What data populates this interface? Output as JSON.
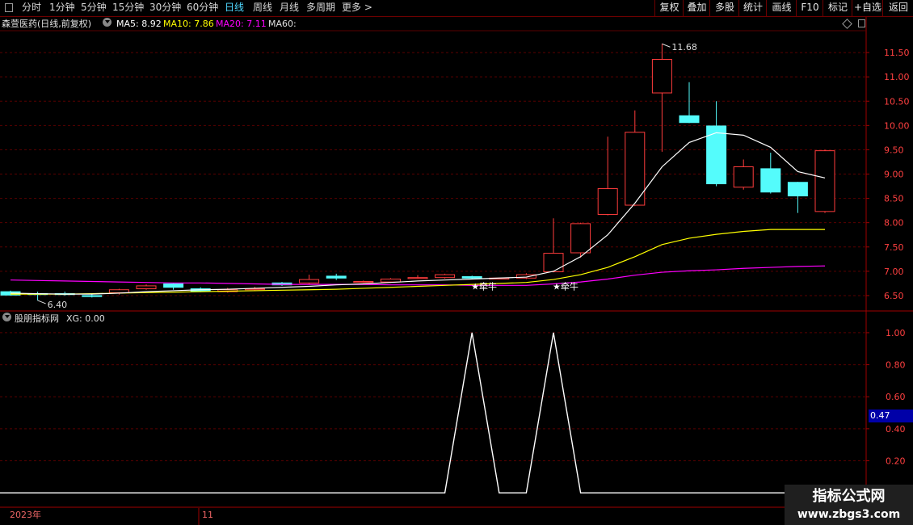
{
  "toolbar": {
    "period_items": [
      "分时",
      "1分钟",
      "5分钟",
      "15分钟",
      "30分钟",
      "60分钟",
      "日线",
      "周线",
      "月线",
      "多周期",
      "更多 >"
    ],
    "active_period": "日线",
    "right_buttons": [
      "复权",
      "叠加",
      "多股",
      "统计",
      "画线",
      "F10",
      "标记",
      "+自选",
      "返回"
    ]
  },
  "indicator_bar": {
    "stock_name": "森萱医药(日线,前复权)",
    "ma5": "MA5: 8.92",
    "ma10": "MA10: 7.86",
    "ma20": "MA20: 7.11",
    "ma60": "MA60:"
  },
  "sub_indicator": {
    "name": "股朋指标网",
    "xg": "XG: 0.00",
    "current_value": "0.47"
  },
  "colors": {
    "up": "#ff3c3c",
    "down": "#54fcfc",
    "ma5": "#ffffff",
    "ma10": "#ffff00",
    "ma20": "#ff00ff",
    "grid": "#5a0000"
  },
  "chart_data": [
    {
      "type": "candlestick",
      "title": "森萱医药(日线,前复权)",
      "yticks": [
        11.5,
        11.0,
        10.5,
        10.0,
        9.5,
        9.0,
        8.5,
        8.0,
        7.5,
        7.0,
        6.5
      ],
      "ylim": [
        6.2,
        11.95
      ],
      "annotations": {
        "high_label": "11.68",
        "low_label": "6.40",
        "signal_label": "★牵牛"
      },
      "candles": [
        {
          "o": 6.58,
          "c": 6.51,
          "h": 6.6,
          "l": 6.5
        },
        {
          "o": 6.54,
          "c": 6.52,
          "h": 6.58,
          "l": 6.4
        },
        {
          "o": 6.54,
          "c": 6.53,
          "h": 6.58,
          "l": 6.5
        },
        {
          "o": 6.5,
          "c": 6.48,
          "h": 6.53,
          "l": 6.46
        },
        {
          "o": 6.56,
          "c": 6.62,
          "h": 6.64,
          "l": 6.52
        },
        {
          "o": 6.64,
          "c": 6.7,
          "h": 6.73,
          "l": 6.62
        },
        {
          "o": 6.74,
          "c": 6.67,
          "h": 6.76,
          "l": 6.62
        },
        {
          "o": 6.64,
          "c": 6.59,
          "h": 6.67,
          "l": 6.57
        },
        {
          "o": 6.58,
          "c": 6.62,
          "h": 6.66,
          "l": 6.56
        },
        {
          "o": 6.62,
          "c": 6.64,
          "h": 6.68,
          "l": 6.6
        },
        {
          "o": 6.76,
          "c": 6.72,
          "h": 6.78,
          "l": 6.7
        },
        {
          "o": 6.76,
          "c": 6.83,
          "h": 6.93,
          "l": 6.74
        },
        {
          "o": 6.9,
          "c": 6.86,
          "h": 6.95,
          "l": 6.82
        },
        {
          "o": 6.79,
          "c": 6.79,
          "h": 6.81,
          "l": 6.76
        },
        {
          "o": 6.78,
          "c": 6.84,
          "h": 6.86,
          "l": 6.76
        },
        {
          "o": 6.86,
          "c": 6.87,
          "h": 6.92,
          "l": 6.84
        },
        {
          "o": 6.87,
          "c": 6.93,
          "h": 6.95,
          "l": 6.85
        },
        {
          "o": 6.89,
          "c": 6.86,
          "h": 6.91,
          "l": 6.84
        },
        {
          "o": 6.86,
          "c": 6.86,
          "h": 6.87,
          "l": 6.84
        },
        {
          "o": 6.86,
          "c": 6.93,
          "h": 6.96,
          "l": 6.84
        },
        {
          "o": 6.99,
          "c": 7.37,
          "h": 8.09,
          "l": 6.98
        },
        {
          "o": 7.38,
          "c": 7.98,
          "h": 8.0,
          "l": 7.28
        },
        {
          "o": 8.17,
          "c": 8.7,
          "h": 9.77,
          "l": 8.15
        },
        {
          "o": 8.36,
          "c": 9.86,
          "h": 10.31,
          "l": 8.34
        },
        {
          "o": 10.67,
          "c": 11.36,
          "h": 11.68,
          "l": 9.46
        },
        {
          "o": 10.2,
          "c": 10.06,
          "h": 10.89,
          "l": 10.05
        },
        {
          "o": 9.99,
          "c": 8.8,
          "h": 10.5,
          "l": 8.75
        },
        {
          "o": 8.73,
          "c": 9.15,
          "h": 9.3,
          "l": 8.68
        },
        {
          "o": 9.11,
          "c": 8.63,
          "h": 9.44,
          "l": 8.6
        },
        {
          "o": 8.83,
          "c": 8.55,
          "h": 8.84,
          "l": 8.2
        },
        {
          "o": 8.23,
          "c": 9.48,
          "h": 9.5,
          "l": 8.2
        }
      ],
      "ma5": [
        6.55,
        6.54,
        6.53,
        6.53,
        6.55,
        6.58,
        6.6,
        6.62,
        6.63,
        6.65,
        6.67,
        6.69,
        6.72,
        6.74,
        6.77,
        6.8,
        6.82,
        6.84,
        6.86,
        6.88,
        7.0,
        7.3,
        7.75,
        8.4,
        9.15,
        9.65,
        9.85,
        9.8,
        9.55,
        9.05,
        8.92
      ],
      "ma10": [
        6.53,
        6.53,
        6.53,
        6.54,
        6.55,
        6.56,
        6.57,
        6.58,
        6.59,
        6.6,
        6.61,
        6.62,
        6.63,
        6.65,
        6.67,
        6.69,
        6.71,
        6.73,
        6.75,
        6.77,
        6.83,
        6.93,
        7.08,
        7.3,
        7.55,
        7.68,
        7.76,
        7.82,
        7.86,
        7.86,
        7.86
      ],
      "ma20": [
        6.82,
        6.81,
        6.8,
        6.79,
        6.78,
        6.77,
        6.76,
        6.76,
        6.75,
        6.74,
        6.73,
        6.73,
        6.73,
        6.73,
        6.72,
        6.72,
        6.72,
        6.71,
        6.71,
        6.71,
        6.74,
        6.78,
        6.84,
        6.92,
        6.98,
        7.01,
        7.03,
        7.06,
        7.08,
        7.1,
        7.11
      ]
    },
    {
      "type": "line",
      "title": "股朋指标网 XG",
      "yticks": [
        1.0,
        0.8,
        0.6,
        0.4,
        0.2
      ],
      "ylim": [
        -0.08,
        1.04
      ],
      "values": [
        0,
        0,
        0,
        0,
        0,
        0,
        0,
        0,
        0,
        0,
        0,
        0,
        0,
        0,
        0,
        0,
        0,
        1,
        0,
        0,
        1,
        0,
        0,
        0,
        0,
        0,
        0,
        0,
        0,
        0,
        0
      ]
    }
  ],
  "x_axis": {
    "left_label": "2023年",
    "mid_label": "11"
  },
  "watermark": {
    "line1": "指标公式网",
    "line2": "www.zbgs3.com"
  }
}
